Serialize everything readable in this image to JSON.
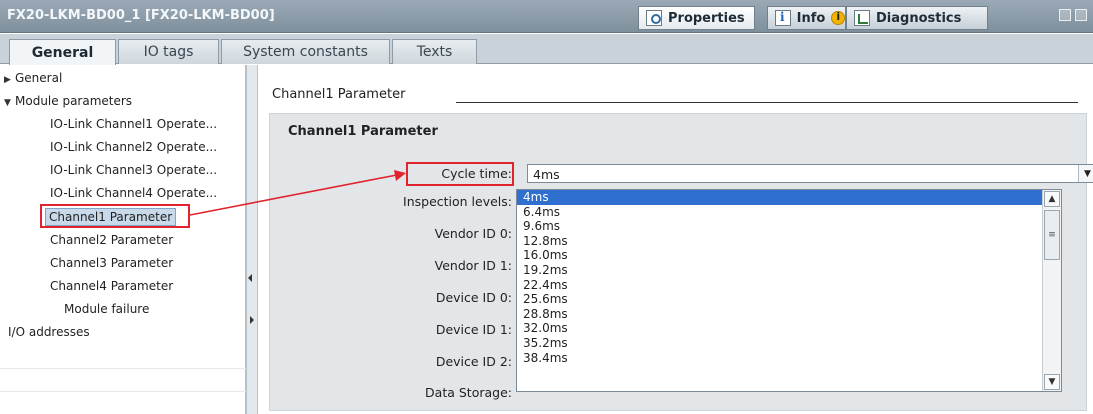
{
  "window": {
    "title": "FX20-LKM-BD00_1 [FX20-LKM-BD00]",
    "tabs": {
      "properties": "Properties",
      "info": "Info",
      "diagnostics": "Diagnostics"
    }
  },
  "subtabs": [
    "General",
    "IO tags",
    "System constants",
    "Texts"
  ],
  "tree": {
    "general": "General",
    "module_parameters": "Module parameters",
    "items": [
      "IO-Link Channel1 Operate...",
      "IO-Link Channel2 Operate...",
      "IO-Link Channel3 Operate...",
      "IO-Link Channel4 Operate...",
      "Channel1 Parameter",
      "Channel2 Parameter",
      "Channel3 Parameter",
      "Channel4 Parameter",
      "Module failure"
    ],
    "io_addresses": "I/O addresses"
  },
  "main": {
    "section_title": "Channel1 Parameter",
    "group_title": "Channel1 Parameter",
    "labels": {
      "cycle_time": "Cycle time:",
      "inspection_levels": "Inspection levels:",
      "vendor_id_0": "Vendor ID 0:",
      "vendor_id_1": "Vendor ID 1:",
      "device_id_0": "Device ID 0:",
      "device_id_1": "Device ID 1:",
      "device_id_2": "Device ID 2:",
      "data_storage": "Data Storage:"
    },
    "cycle_time_value": "4ms",
    "options": [
      "4ms",
      "6.4ms",
      "9.6ms",
      "12.8ms",
      "16.0ms",
      "19.2ms",
      "22.4ms",
      "25.6ms",
      "28.8ms",
      "32.0ms",
      "35.2ms",
      "38.4ms"
    ]
  },
  "colors": {
    "highlight": "#2f6fd0",
    "annotation": "#e0232c",
    "titlebar": "#8c9ca8"
  }
}
